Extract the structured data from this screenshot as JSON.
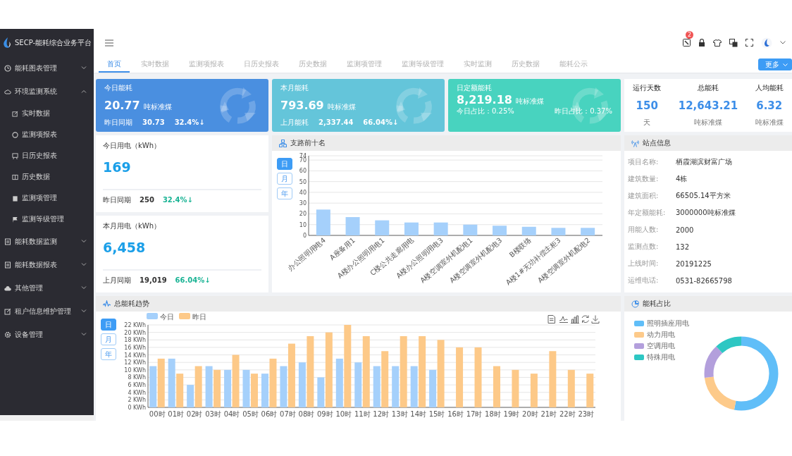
{
  "app": {
    "title": "SECP-能耗综合业务平台"
  },
  "sidebar": {
    "items": [
      {
        "label": "能耗图表管理",
        "expanded": false
      },
      {
        "label": "环境监测系统",
        "expanded": true,
        "children": [
          {
            "label": "实时数据"
          },
          {
            "label": "监测项报表"
          },
          {
            "label": "日历史报表"
          },
          {
            "label": "历史数据"
          },
          {
            "label": "监测项管理"
          },
          {
            "label": "监测等级管理"
          }
        ]
      },
      {
        "label": "能耗数据监测",
        "expanded": false
      },
      {
        "label": "能耗数据报表",
        "expanded": false
      },
      {
        "label": "其他管理",
        "expanded": false
      },
      {
        "label": "租户信息维护管理",
        "expanded": false
      },
      {
        "label": "设备管理",
        "expanded": false
      }
    ]
  },
  "header": {
    "notification_count": "2"
  },
  "tabs": [
    {
      "label": "首页",
      "selected": true
    },
    {
      "label": "实时数据",
      "selected": false
    },
    {
      "label": "监测项报表",
      "selected": false
    },
    {
      "label": "日历史报表",
      "selected": false
    },
    {
      "label": "历史数据",
      "selected": false
    },
    {
      "label": "监测项管理",
      "selected": false
    },
    {
      "label": "监测等级管理",
      "selected": false
    },
    {
      "label": "实时监测",
      "selected": false
    },
    {
      "label": "历史数据",
      "selected": false
    },
    {
      "label": "能耗公示",
      "selected": false
    }
  ],
  "more_button": "更多",
  "summary_cards": [
    {
      "kind": "comparison",
      "color": "#4a8fe0",
      "title": "今日能耗",
      "value": "20.77",
      "unit": "吨标准煤",
      "footer": [
        "昨日同期",
        "30.73",
        "32.4%↓"
      ]
    },
    {
      "kind": "comparison",
      "color": "#64c5da",
      "title": "本月能耗",
      "value": "793.69",
      "unit": "吨标准煤",
      "footer": [
        "上月能耗",
        "2,337.44",
        "66.04%↓"
      ]
    },
    {
      "kind": "share",
      "color": "#48d3bf",
      "title": "日定额能耗",
      "value": "8,219.18",
      "unit": "吨标准煤",
      "footer": [
        "今日占比：0.25%",
        "昨日占比：0.37%"
      ]
    }
  ],
  "stats": [
    {
      "label": "运行天数",
      "value": "150",
      "unit": "天"
    },
    {
      "label": "总能耗",
      "value": "12,643.21",
      "unit": "吨标准煤"
    },
    {
      "label": "人均能耗",
      "value": "6.32",
      "unit": "吨标准煤"
    }
  ],
  "electricity": [
    {
      "title": "今日用电（kWh）",
      "value": "169",
      "compare_label": "昨日同期",
      "compare_value": "250",
      "change": "32.4%↓"
    },
    {
      "title": "本月用电（kWh）",
      "value": "6,458",
      "compare_label": "上月同期",
      "compare_value": "19,019",
      "change": "66.04%↓"
    }
  ],
  "branch_ranking": {
    "title": "支路前十名",
    "periods": [
      {
        "label": "日",
        "selected": true
      },
      {
        "label": "月",
        "selected": false
      },
      {
        "label": "年",
        "selected": false
      }
    ],
    "chart_data": {
      "type": "bar",
      "categories": [
        "办公照明用电4",
        "A座备用1",
        "A楼办公照明用电1",
        "C楼公共走廊用电",
        "A楼办公照明用电3",
        "A楼空调室外机配电1",
        "A楼空调室外机配电3",
        "B楼联络",
        "A楼1#无功补偿主柜3",
        "A楼空调室外机配电2"
      ],
      "values": [
        24,
        17,
        14,
        12,
        12,
        10,
        9,
        8,
        7,
        7
      ],
      "yticks": [
        0,
        10,
        20,
        30,
        40,
        50,
        60,
        70,
        74
      ],
      "ylim": [
        0,
        74
      ],
      "grid": true
    }
  },
  "site_info": {
    "title": "站点信息",
    "fields": [
      {
        "label": "项目名称:",
        "value": "栖霞湖滨财富广场"
      },
      {
        "label": "建筑数量:",
        "value": "4栋"
      },
      {
        "label": "建筑面积:",
        "value": "66505.14平方米"
      },
      {
        "label": "年定额能耗:",
        "value": "3000000吨标准煤"
      },
      {
        "label": "用能人数:",
        "value": "2000"
      },
      {
        "label": "监测点数:",
        "value": "132"
      },
      {
        "label": "上线时间:",
        "value": "20191225"
      },
      {
        "label": "运维电话:",
        "value": "0531-82665798"
      }
    ]
  },
  "trend": {
    "title": "总能耗趋势",
    "periods": [
      {
        "label": "日",
        "selected": true
      },
      {
        "label": "月",
        "selected": false
      },
      {
        "label": "年",
        "selected": false
      }
    ],
    "chart_data": {
      "type": "bar",
      "categories": [
        "00时",
        "01时",
        "02时",
        "03时",
        "04时",
        "05时",
        "06时",
        "07时",
        "08时",
        "09时",
        "10时",
        "11时",
        "12时",
        "13时",
        "14时",
        "15时",
        "16时",
        "17时",
        "18时",
        "19时",
        "20时",
        "21时",
        "22时",
        "23时"
      ],
      "series": [
        {
          "name": "今日",
          "color": "#a5d0fb",
          "values": [
            11,
            13,
            6,
            11,
            10,
            10,
            9,
            11,
            12,
            8,
            13,
            12,
            11,
            11,
            11,
            10,
            null,
            null,
            null,
            null,
            null,
            null,
            null,
            null
          ]
        },
        {
          "name": "昨日",
          "color": "#fdc988",
          "values": [
            13,
            9,
            11,
            10,
            14,
            9,
            13,
            17,
            19,
            20,
            22,
            19,
            15,
            19,
            19,
            18,
            16,
            16,
            11,
            10,
            9,
            15,
            10,
            9
          ]
        }
      ],
      "yticks": [
        {
          "value": 0,
          "label": "0 KWh"
        },
        {
          "value": 2,
          "label": "2 KWh"
        },
        {
          "value": 4,
          "label": "4 KWh"
        },
        {
          "value": 6,
          "label": "6 KWh"
        },
        {
          "value": 8,
          "label": "8 KWh"
        },
        {
          "value": 10,
          "label": "10 KWh"
        },
        {
          "value": 12,
          "label": "12 KWh"
        },
        {
          "value": 14,
          "label": "14 KWh"
        },
        {
          "value": 16,
          "label": "16 KWh"
        },
        {
          "value": 18,
          "label": "18 KWh"
        },
        {
          "value": 20,
          "label": "20 KWh"
        },
        {
          "value": 22,
          "label": "22 KWh"
        }
      ],
      "ylim": [
        0,
        22
      ],
      "grid": true,
      "legend": true
    }
  },
  "energy_share": {
    "title": "能耗占比",
    "legend": [
      {
        "label": "照明插座用电",
        "color": "#60bef8"
      },
      {
        "label": "动力用电",
        "color": "#fdca8a"
      },
      {
        "label": "空调用电",
        "color": "#b39fdc"
      },
      {
        "label": "特殊用电",
        "color": "#2dc7c3"
      }
    ]
  }
}
